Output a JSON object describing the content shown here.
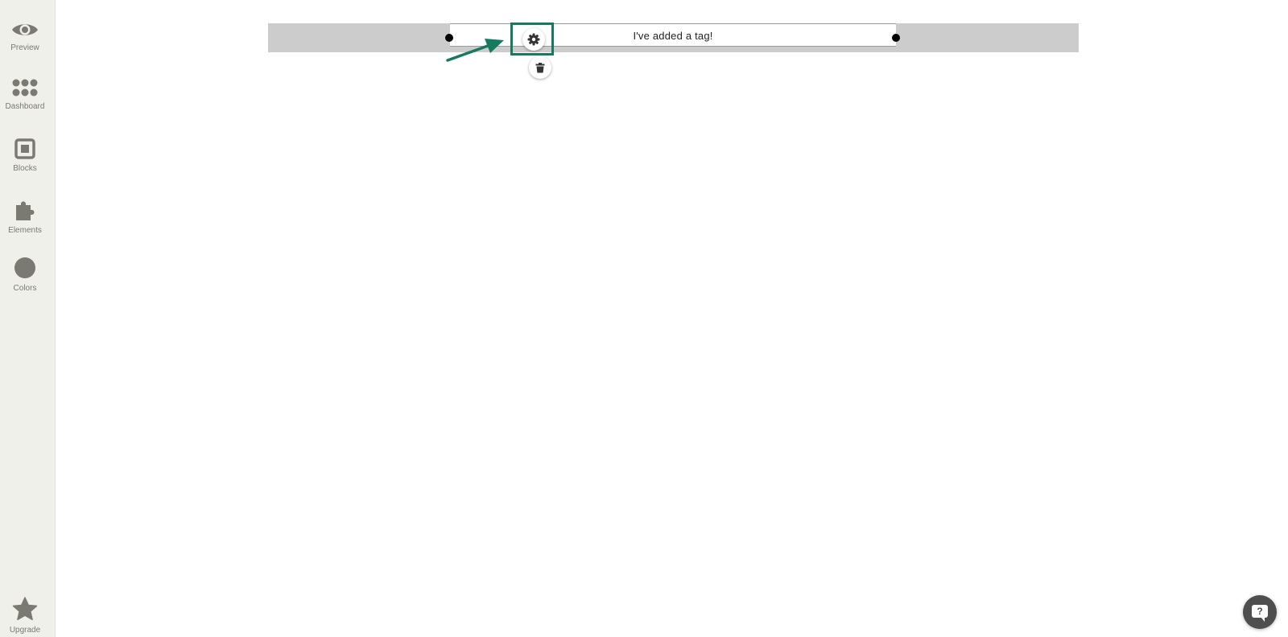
{
  "sidebar": {
    "items": [
      {
        "label": "Preview",
        "icon": "eye-icon"
      },
      {
        "label": "Dashboard",
        "icon": "dots-grid-icon"
      },
      {
        "label": "Blocks",
        "icon": "block-square-icon"
      },
      {
        "label": "Elements",
        "icon": "puzzle-piece-icon"
      },
      {
        "label": "Colors",
        "icon": "color-circle-icon"
      }
    ],
    "upgrade": {
      "label": "Upgrade",
      "icon": "star-icon"
    }
  },
  "editor": {
    "tag_text": "I've added a tag!",
    "settings_icon": "gear-icon",
    "delete_icon": "trash-icon"
  },
  "annotation": {
    "highlight_color": "#167a5e",
    "arrow_color": "#167a5e"
  },
  "help": {
    "glyph": "?",
    "icon": "chat-help-icon"
  },
  "colors": {
    "sidebar_bg": "#f0f0eb",
    "icon_gray": "#7a7a72",
    "canvas_bar": "#cccccc"
  }
}
